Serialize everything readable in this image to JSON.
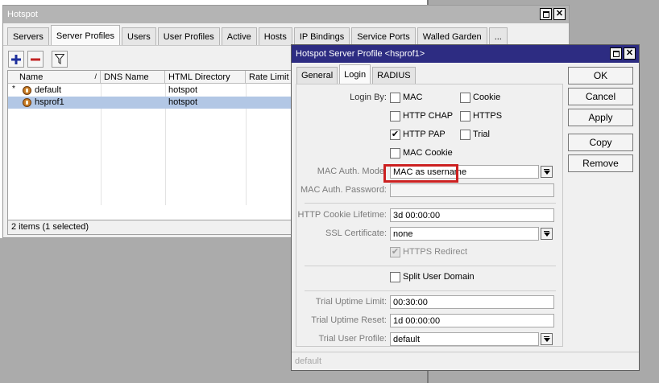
{
  "hotspot": {
    "title": "Hotspot",
    "tabs": [
      "Servers",
      "Server Profiles",
      "Users",
      "User Profiles",
      "Active",
      "Hosts",
      "IP Bindings",
      "Service Ports",
      "Walled Garden",
      "..."
    ],
    "list": {
      "columns": [
        "Name",
        "DNS Name",
        "HTML Directory",
        "Rate Limit (rx"
      ],
      "rows": [
        {
          "marker": "*",
          "name": "default",
          "dns": "",
          "html_dir": "hotspot"
        },
        {
          "marker": "",
          "name": "hsprof1",
          "dns": "",
          "html_dir": "hotspot"
        }
      ]
    },
    "status": "2 items (1 selected)"
  },
  "dialog": {
    "title": "Hotspot Server Profile <hsprof1>",
    "tabs": [
      "General",
      "Login",
      "RADIUS"
    ],
    "login_by_label": "Login By:",
    "login_methods": {
      "mac": {
        "label": "MAC",
        "checked": false
      },
      "cookie": {
        "label": "Cookie",
        "checked": false
      },
      "http_chap": {
        "label": "HTTP CHAP",
        "checked": false
      },
      "https": {
        "label": "HTTPS",
        "checked": false
      },
      "http_pap": {
        "label": "HTTP PAP",
        "checked": true
      },
      "trial": {
        "label": "Trial",
        "checked": false
      },
      "mac_cookie": {
        "label": "MAC Cookie",
        "checked": false
      }
    },
    "mac_auth_mode": {
      "label": "MAC Auth. Mode:",
      "value": "MAC as username"
    },
    "mac_auth_password": {
      "label": "MAC Auth. Password:",
      "value": ""
    },
    "http_cookie_lifetime": {
      "label": "HTTP Cookie Lifetime:",
      "value": "3d 00:00:00"
    },
    "ssl_certificate": {
      "label": "SSL Certificate:",
      "value": "none"
    },
    "https_redirect": {
      "label": "HTTPS Redirect",
      "checked": true
    },
    "split_user_domain": {
      "label": "Split User Domain",
      "checked": false
    },
    "trial_uptime_limit": {
      "label": "Trial Uptime Limit:",
      "value": "00:30:00"
    },
    "trial_uptime_reset": {
      "label": "Trial Uptime Reset:",
      "value": "1d 00:00:00"
    },
    "trial_user_profile": {
      "label": "Trial User Profile:",
      "value": "default"
    },
    "buttons": {
      "ok": "OK",
      "cancel": "Cancel",
      "apply": "Apply",
      "copy": "Copy",
      "remove": "Remove"
    },
    "status": "default"
  }
}
